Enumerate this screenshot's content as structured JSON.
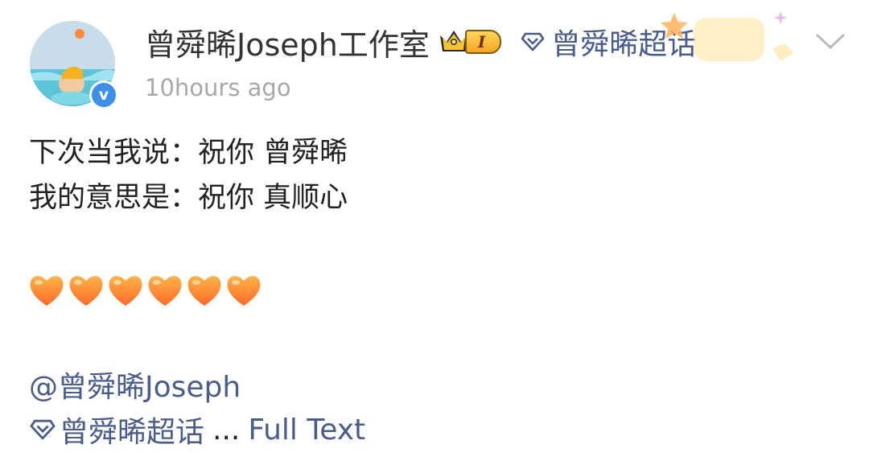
{
  "post": {
    "author": {
      "name": "曾舜晞Joseph工作室",
      "vip_level": "I",
      "verified": "v"
    },
    "supertopic_label": "曾舜晞超话",
    "timestamp": "10hours ago",
    "content_lines": [
      "下次当我说：祝你 曾舜晞",
      "我的意思是：祝你 真顺心"
    ],
    "emoji_row": "🧡🧡🧡🧡🧡🧡",
    "mention": "@曾舜晞Joseph",
    "topic_link": "曾舜晞超话",
    "ellipsis": "...",
    "full_text_label": "Full Text"
  },
  "colors": {
    "link": "#4a5c8a",
    "text": "#222222",
    "timestamp": "#a8a8a8",
    "verified": "#3d8fe8",
    "heart": "#ff8a1e"
  }
}
